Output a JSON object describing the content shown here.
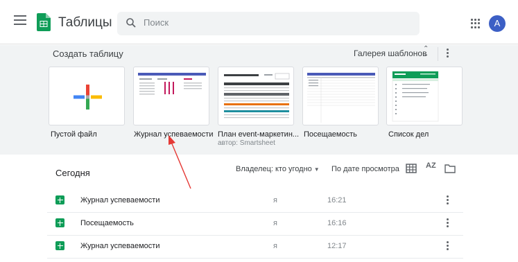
{
  "header": {
    "app_title": "Таблицы",
    "search_placeholder": "Поиск",
    "avatar_letter": "A"
  },
  "templates": {
    "heading": "Создать таблицу",
    "gallery_label": "Галерея шаблонов",
    "cards": [
      {
        "label": "Пустой файл",
        "sub": ""
      },
      {
        "label": "Журнал успеваемости",
        "sub": ""
      },
      {
        "label": "План event-маркетин...",
        "sub": "автор: Smartsheet"
      },
      {
        "label": "Посещаемость",
        "sub": ""
      },
      {
        "label": "Список дел",
        "sub": ""
      }
    ]
  },
  "list": {
    "section_title": "Сегодня",
    "owner_filter": "Владелец: кто угодно",
    "sort_label": "По дате просмотра",
    "sort_icon_text": "AZ",
    "rows": [
      {
        "name": "Журнал успеваемости",
        "owner": "я",
        "time": "16:21"
      },
      {
        "name": "Посещаемость",
        "owner": "я",
        "time": "16:16"
      },
      {
        "name": "Журнал успеваемости",
        "owner": "я",
        "time": "12:17"
      }
    ]
  },
  "colors": {
    "brand_green": "#0f9d58",
    "avatar_blue": "#3c5fc5",
    "annotation_red": "#e53935",
    "templates_bg": "#f1f3f4"
  }
}
